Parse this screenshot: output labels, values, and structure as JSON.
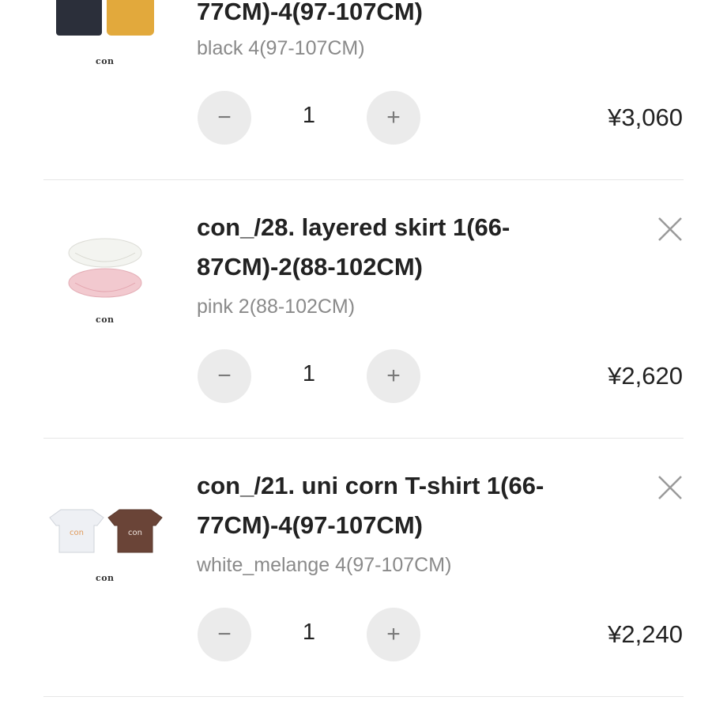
{
  "cart": {
    "items": [
      {
        "title_line1": "",
        "title_line2": "77CM)-4(97-107CM)",
        "variant": "black 4(97-107CM)",
        "brand": "con",
        "quantity": "1",
        "price": "¥3,060"
      },
      {
        "title_line1": "con_/28. layered skirt 1(66-",
        "title_line2": "87CM)-2(88-102CM)",
        "variant": "pink 2(88-102CM)",
        "brand": "con",
        "quantity": "1",
        "price": "¥2,620"
      },
      {
        "title_line1": "con_/21. uni corn T-shirt 1(66-",
        "title_line2": "77CM)-4(97-107CM)",
        "variant": "white_melange 4(97-107CM)",
        "brand": "con",
        "quantity": "1",
        "price": "¥2,240"
      }
    ],
    "icons": {
      "minus": "minus-icon",
      "plus": "plus-icon",
      "remove": "close-icon"
    },
    "colors": {
      "button_bg": "#ebebeb",
      "variant_text": "#8a8a8a",
      "divider": "#e6e6e6"
    }
  }
}
